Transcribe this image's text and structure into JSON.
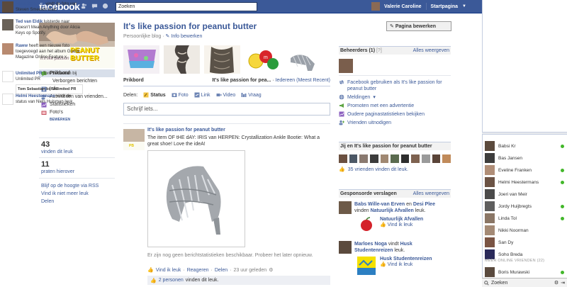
{
  "header": {
    "logo": "facebook",
    "search_placeholder": "Zoeken",
    "user_name": "Valerie Caroline",
    "home": "Startpagina"
  },
  "page": {
    "title": "It's like passion for peanut butter",
    "category": "Persoonlijke blog",
    "sep": " · ",
    "info_edit": "Info bewerken",
    "edit_button": "Pagina bewerken",
    "cover_title": "It's like passion for",
    "cover_brand": "PEANUT BUTTER"
  },
  "sidebar": {
    "items": [
      {
        "label": "Prikbord",
        "active": true
      },
      {
        "label": "Verborgen berichten",
        "sub": true
      },
      {
        "label": "Info"
      },
      {
        "label": "Activiteiten van vrienden..."
      },
      {
        "label": "Statistieken"
      },
      {
        "label": "Foto's"
      }
    ],
    "more": "BEWERKEN",
    "likes_count": "43",
    "likes_label": "vinden dit leuk",
    "talk_count": "11",
    "talk_label": "praten hierover",
    "links": [
      "Blijf op de hoogte via RSS",
      "Vind ik niet meer leuk",
      "Delen"
    ]
  },
  "wall": {
    "tab": "Prikbord",
    "filter_prefix": "It's like passion for pea...",
    "filter_sep": " · ",
    "filter_suffix": "Iedereen (Meest Recent)",
    "share_label": "Delen:",
    "share_opts": [
      "Status",
      "Foto",
      "Link",
      "Video",
      "Vraag"
    ],
    "composer_placeholder": "Schrijf iets...",
    "post": {
      "author": "It's like passion for peanut butter",
      "text": "The item OF tHE dAY: IRIS van HERPEN: Crystallization Ankle Bootie: What a great shoe! Love the ideA!",
      "note": "Er zijn nog geen berichtstatistieken beschikbaar. Probeer het later opnieuw.",
      "actions": [
        "Vind ik leuk",
        "Reageren",
        "Delen",
        "23 uur geleden"
      ],
      "likes_count": "2 personen",
      "likes_label": "vinden dit leuk."
    }
  },
  "admins": {
    "title": "Beheerders (1)",
    "help": "[?]",
    "all": "Alles weergeven",
    "links": [
      "Facebook gebruiken als It's like passion for peanut butter",
      "Meldingen",
      "Promoten met een advertentie",
      "Oudere paginastatistieken bekijken",
      "Vrienden uitnodigen"
    ]
  },
  "friends_like": {
    "title": "Jij en It's like passion for peanut butter",
    "count_text": "35 vrienden vinden dit leuk."
  },
  "sponsored": {
    "title": "Gesponsorde verslagen",
    "all": "Alles weergeven",
    "stories": [
      {
        "who": "Babs Wille-van Erven",
        "mid": " en ",
        "who2": "Desi Plee",
        "verb": " vinden ",
        "page": "Natuurlijk Afvallen",
        "tail": " leuk.",
        "title": "Natuurlijk Afvallen",
        "cta": "Vind ik leuk"
      },
      {
        "who": "Marloes Noga",
        "mid": "",
        "who2": "",
        "verb": " vindt ",
        "page": "Husk Studentenreizen",
        "tail": " leuk.",
        "title": "Husk Studentenreizen",
        "cta": "Vind ik leuk"
      }
    ]
  },
  "ticker": [
    {
      "name": "Niels Smeelen",
      "text": " vindt de foto van Steven Smeelen leuk."
    },
    {
      "name": "Ted van Eldik",
      "text": " luisterde naar Doesn't Mean Anything door Alicia Keys op Spotify."
    },
    {
      "name": "Raww",
      "text": " heeft een nieuwe foto toegevoegd aan het album Grazia Magazine Online Feature x."
    },
    {
      "name": "Unlimited PR",
      "text": " Tom Sebastian bij Unlimited PR",
      "extra": "Tom Sebastian bij Unlimited PR"
    },
    {
      "name": "Helmi Heestermans",
      "text": " vindt de status van Niels Huisman leuk."
    }
  ],
  "chat": {
    "friends": [
      {
        "name": "Babsi Kr",
        "online": true
      },
      {
        "name": "Bas Jansen",
        "online": false
      },
      {
        "name": "Eveline Franken",
        "online": true
      },
      {
        "name": "Helmi Heestermans",
        "online": true
      },
      {
        "name": "Joeri van Meir",
        "online": false
      },
      {
        "name": "Jordy Huijbregts",
        "online": true
      },
      {
        "name": "Linda Tol",
        "online": true
      },
      {
        "name": "Nikki Noorman",
        "online": false
      },
      {
        "name": "San Dy",
        "online": false
      },
      {
        "name": "Soho Breda",
        "online": false
      }
    ],
    "more_label": "MEER ONLINE VRIENDEN (22)",
    "more_friend": {
      "name": "Boris Murawski",
      "online": true
    },
    "search_placeholder": "Zoeken"
  },
  "colors": {
    "brand": "#3b5998",
    "online": "#42b72a"
  }
}
